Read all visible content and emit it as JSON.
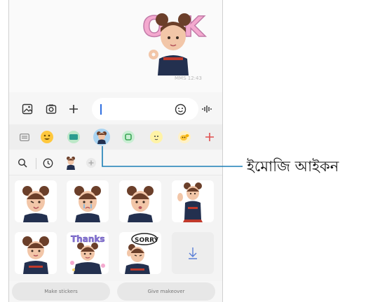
{
  "chat": {
    "sent_sticker_text": "OK",
    "timestamp": "MMS 12:43"
  },
  "composer": {
    "input_value": "",
    "icons": [
      "gallery-icon",
      "camera-icon",
      "plus-icon",
      "emoji-icon",
      "voice-icon"
    ]
  },
  "categories": [
    {
      "name": "keyboard-icon",
      "selected": false
    },
    {
      "name": "emoji-icon",
      "selected": false
    },
    {
      "name": "gif-icon",
      "selected": false
    },
    {
      "name": "ar-emoji-icon",
      "selected": true
    },
    {
      "name": "sticker-icon",
      "selected": false
    },
    {
      "name": "bitmoji-icon",
      "selected": false
    },
    {
      "name": "mojitok-icon",
      "selected": false
    },
    {
      "name": "add-icon",
      "selected": false
    }
  ],
  "stickers": {
    "row2_labels": [
      "Thanks",
      "SORRY"
    ]
  },
  "buttons": {
    "make_stickers": "Make stickers",
    "give_makeover": "Give makeover"
  },
  "callout": {
    "label": "ইমোজি আইকন"
  },
  "colors": {
    "accent_blue": "#2f6fe0",
    "leader_line": "#1b7fb5",
    "selected_bg": "#a9d4f2"
  }
}
